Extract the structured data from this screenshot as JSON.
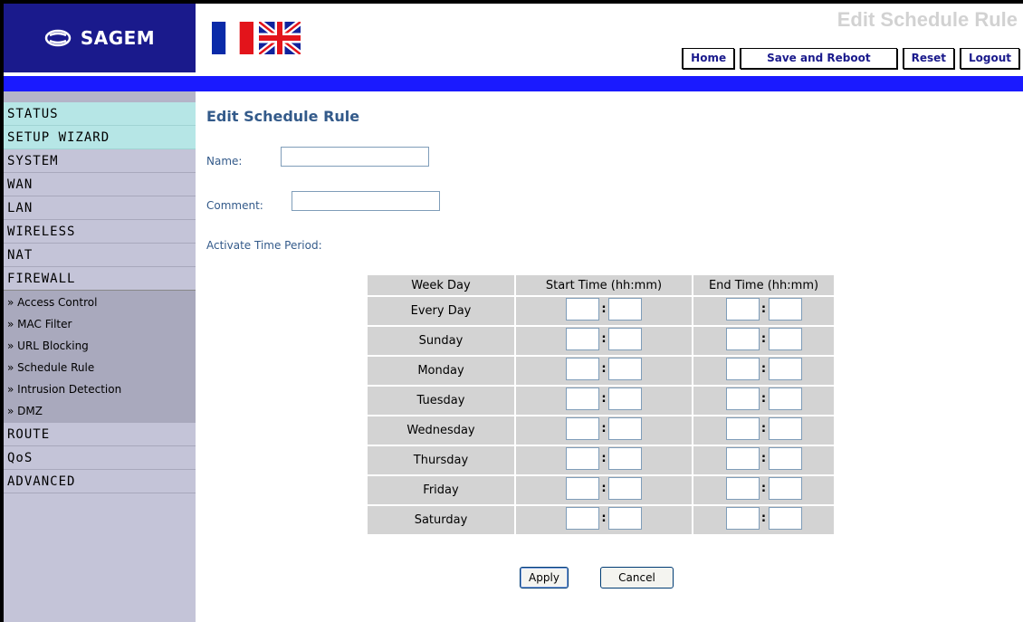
{
  "header": {
    "logo_text": "SAGEM",
    "page_heading": "Edit Schedule Rule",
    "nav": [
      {
        "label": "Home"
      },
      {
        "label": "Save and Reboot"
      },
      {
        "label": "Reset"
      },
      {
        "label": "Logout"
      }
    ]
  },
  "sidebar": {
    "main": [
      {
        "label": "STATUS"
      },
      {
        "label": "SETUP WIZARD"
      },
      {
        "label": "SYSTEM"
      },
      {
        "label": "WAN"
      },
      {
        "label": "LAN"
      },
      {
        "label": "WIRELESS"
      },
      {
        "label": "NAT"
      },
      {
        "label": "FIREWALL"
      }
    ],
    "firewall_sub": [
      {
        "label": "» Access Control"
      },
      {
        "label": "» MAC Filter"
      },
      {
        "label": "» URL Blocking"
      },
      {
        "label": "» Schedule Rule"
      },
      {
        "label": "» Intrusion Detection"
      },
      {
        "label": "» DMZ"
      }
    ],
    "after": [
      {
        "label": "ROUTE"
      },
      {
        "label": "QoS"
      },
      {
        "label": "ADVANCED"
      }
    ]
  },
  "form": {
    "title": "Edit Schedule Rule",
    "name_label": "Name:",
    "name_value": "",
    "comment_label": "Comment:",
    "comment_value": "",
    "period_label": "Activate Time Period:"
  },
  "schedule": {
    "headers": [
      "Week Day",
      "Start Time (hh:mm)",
      "End Time (hh:mm)"
    ],
    "days": [
      "Every Day",
      "Sunday",
      "Monday",
      "Tuesday",
      "Wednesday",
      "Thursday",
      "Friday",
      "Saturday"
    ],
    "separator": ":"
  },
  "buttons": {
    "apply": "Apply",
    "cancel": "Cancel"
  },
  "colors": {
    "logo_bg": "#1a1a8c",
    "blue_bar": "#1a1aff",
    "heading": "#335a8a",
    "sidebar_bg": "#c4c4d8",
    "sidebar_highlight": "#b6e6e6",
    "table_cell": "#d3d3d3"
  }
}
